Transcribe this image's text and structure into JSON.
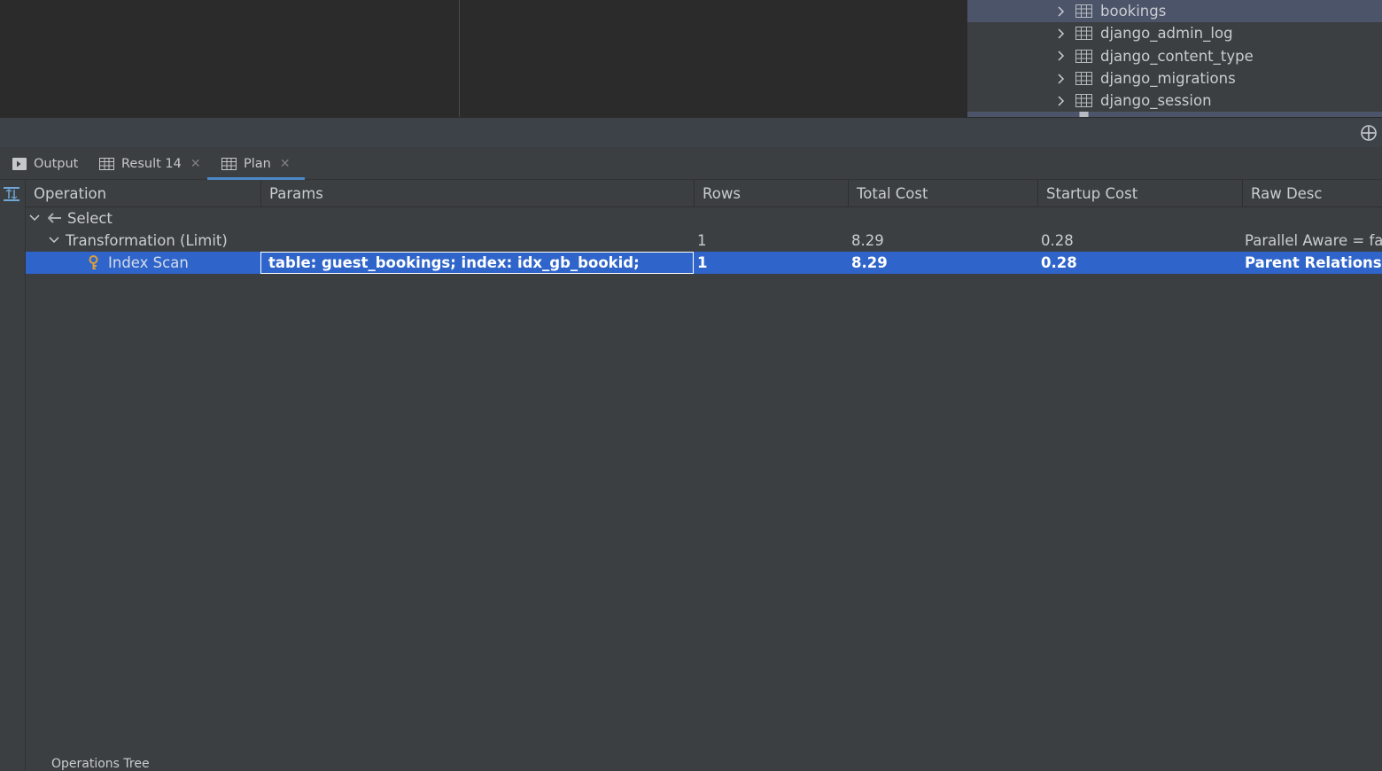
{
  "db_tree": {
    "items": [
      {
        "label": "bookings",
        "selected": true
      },
      {
        "label": "django_admin_log",
        "selected": false
      },
      {
        "label": "django_content_type",
        "selected": false
      },
      {
        "label": "django_migrations",
        "selected": false
      },
      {
        "label": "django_session",
        "selected": false
      }
    ]
  },
  "tabs": [
    {
      "label": "Output",
      "icon": "console-icon",
      "closable": false
    },
    {
      "label": "Result 14",
      "icon": "table-icon",
      "closable": true
    },
    {
      "label": "Plan",
      "icon": "table-icon",
      "closable": true,
      "active": true
    }
  ],
  "plan": {
    "columns": [
      "Operation",
      "Params",
      "Rows",
      "Total Cost",
      "Startup Cost",
      "Raw Desc"
    ],
    "rows": [
      {
        "operation": "Select",
        "params": "",
        "rows": "",
        "total_cost": "",
        "startup_cost": "",
        "raw_desc": ""
      },
      {
        "operation": "Transformation (Limit)",
        "params": "",
        "rows": "1",
        "total_cost": "8.29",
        "startup_cost": "0.28",
        "raw_desc": "Parallel Aware = fal"
      },
      {
        "operation": "Index Scan",
        "params": "table: guest_bookings; index: idx_gb_bookid;",
        "rows": "1",
        "total_cost": "8.29",
        "startup_cost": "0.28",
        "raw_desc": "Parent Relationship"
      }
    ]
  },
  "footer": {
    "label": "Operations Tree"
  },
  "colors": {
    "selection": "#2f65ca",
    "accent": "#4a88c7",
    "key_icon": "#e0a035"
  }
}
